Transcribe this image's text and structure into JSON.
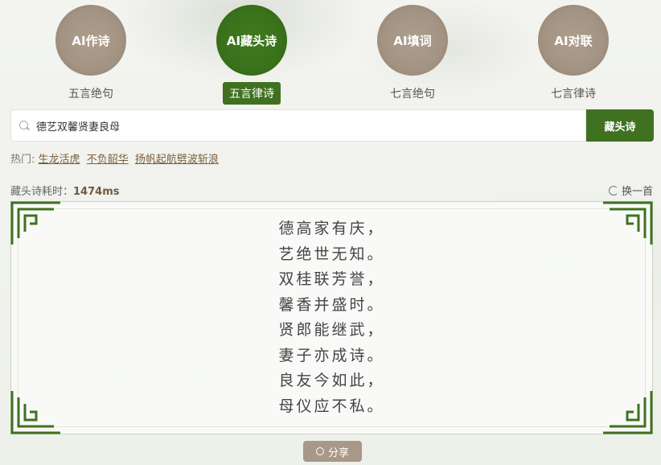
{
  "modes": [
    {
      "title": "AI作诗",
      "sub": "五言绝句"
    },
    {
      "title": "AI藏头诗",
      "sub": "五言律诗"
    },
    {
      "title": "AI填词",
      "sub": "七言绝句"
    },
    {
      "title": "AI对联",
      "sub": "七言律诗"
    }
  ],
  "active_mode_index": 1,
  "search": {
    "value": "德艺双馨贤妻良母",
    "icon": "search-icon"
  },
  "submit_label": "藏头诗",
  "hot": {
    "label": "热门:",
    "tags": [
      "生龙活虎",
      "不负韶华",
      "扬帆起航劈波斩浪"
    ]
  },
  "timing": {
    "label": "藏头诗耗时：",
    "value": "1474ms"
  },
  "refresh_label": "换一首",
  "poem": {
    "lines": [
      "德高家有庆，",
      "艺绝世无知。",
      "双桂联芳誉，",
      "馨香并盛时。",
      "贤郎能继武，",
      "妻子亦成诗。",
      "良友今如此，",
      "母仪应不私。"
    ]
  },
  "share_label": "分享",
  "colors": {
    "accent": "#3f7120",
    "muted": "#a39383",
    "tag": "#7a5f3e"
  }
}
